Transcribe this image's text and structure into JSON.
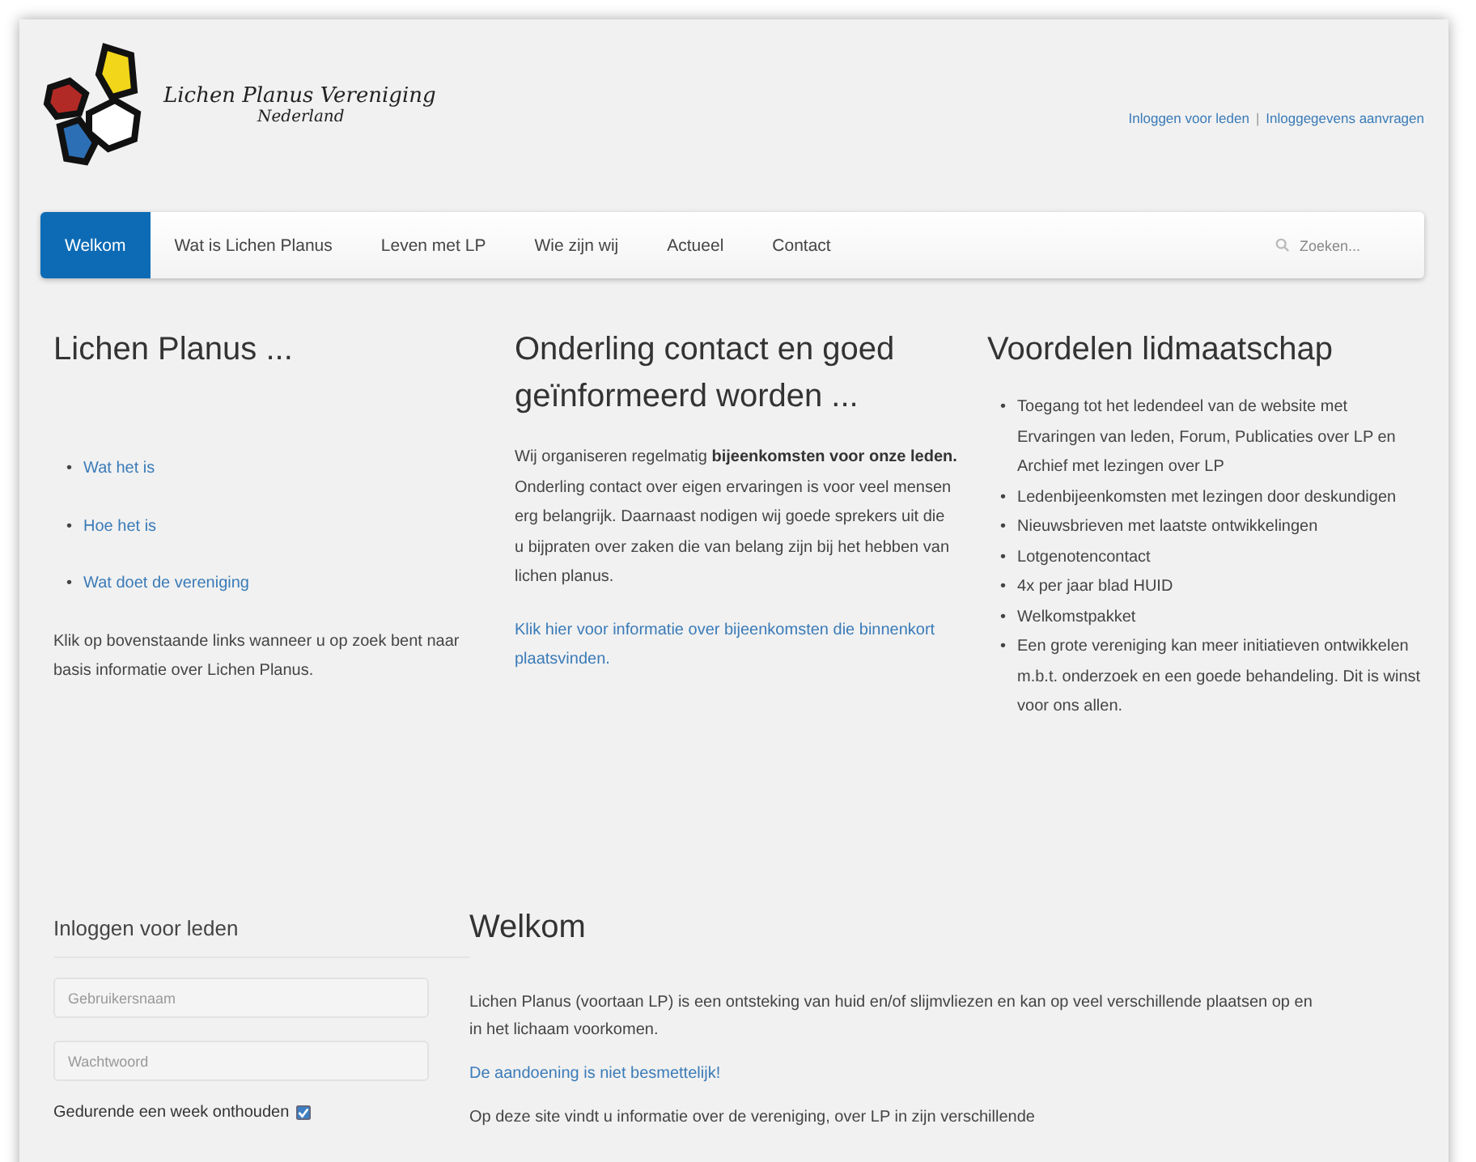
{
  "header": {
    "logo_title": "Lichen Planus Vereniging",
    "logo_subtitle": "Nederland",
    "top_links": [
      "Inloggen voor leden",
      "Inloggegevens aanvragen"
    ],
    "separator": "|"
  },
  "nav": {
    "items": [
      {
        "label": "Welkom",
        "selected": true
      },
      {
        "label": "Wat is Lichen Planus",
        "selected": false
      },
      {
        "label": "Leven met LP",
        "selected": false
      },
      {
        "label": "Wie zijn wij",
        "selected": false
      },
      {
        "label": "Actueel",
        "selected": false
      },
      {
        "label": "Contact",
        "selected": false
      }
    ],
    "search_placeholder": "Zoeken..."
  },
  "columns": [
    {
      "title": "Lichen Planus ...",
      "bullet": "•",
      "links": [
        "Wat het is",
        "Hoe het is",
        "Wat doet de vereniging"
      ],
      "text": "Klik op bovenstaande links wanneer u op zoek bent naar basis informatie over Lichen Planus."
    },
    {
      "title": "Onderling contact en goed geïnformeerd worden ...",
      "text": "Wij organiseren regelmatig **bijeenkomsten voor onze leden.** Onderling contact over eigen ervaringen is voor veel mensen erg belangrijk. Daarnaast nodigen wij goede sprekers uit die u bijpraten over zaken die van belang zijn bij het hebben van lichen planus.",
      "link": "Klik hier voor informatie over bijeenkomsten die binnenkort plaatsvinden."
    },
    {
      "title": "Voordelen lidmaatschap",
      "bullet": "•",
      "bullets": [
        "Toegang tot het ledendeel van de website met Ervaringen van leden, Forum, Publicaties over LP en Archief met lezingen over LP",
        "Ledenbijeenkomsten met lezingen door deskundigen",
        "Nieuwsbrieven met laatste ontwikkelingen",
        "Lotgenotencontact",
        "4x per jaar blad HUID",
        "Welkomstpakket",
        "Een grote vereniging kan meer initiatieven ontwikkelen m.b.t. onderzoek en een goede behandeling. Dit is winst voor ons allen."
      ]
    }
  ],
  "login": {
    "title": "Inloggen voor leden",
    "username_placeholder": "Gebruikersnaam",
    "password_placeholder": "Wachtwoord",
    "remember": {
      "label": "Gedurende een week onthouden",
      "checked": true
    }
  },
  "welcome": {
    "title": "Welkom",
    "paragraphs": [
      {
        "kind": "text",
        "text": "Lichen Planus (voortaan LP) is een ontsteking van huid en/of slijmvliezen en kan op veel verschillende plaatsen op en in het lichaam voorkomen."
      },
      {
        "kind": "link",
        "text": "De aandoening is niet besmettelijk!"
      },
      {
        "kind": "text",
        "text": "Op deze site vindt u informatie over de vereniging, over LP in zijn verschillende"
      }
    ]
  }
}
